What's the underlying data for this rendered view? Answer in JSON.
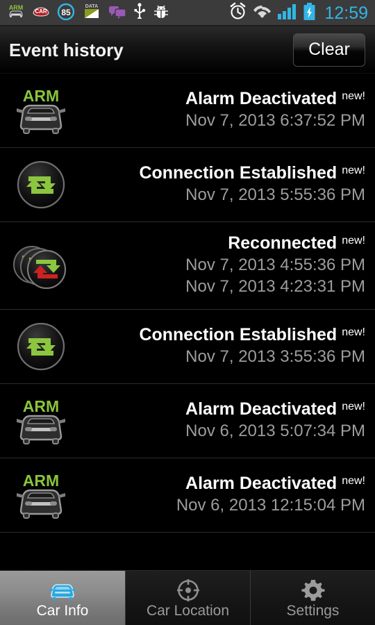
{
  "statusbar": {
    "left_icons": [
      {
        "name": "arm-car-notification-icon",
        "label": "ARM"
      },
      {
        "name": "car-alarm-app-icon",
        "label": "CAR"
      },
      {
        "name": "speed-85-icon",
        "label": "85"
      },
      {
        "name": "data-usage-icon",
        "label": "DATA"
      },
      {
        "name": "messages-icon",
        "label": ""
      },
      {
        "name": "usb-icon",
        "label": ""
      },
      {
        "name": "android-debug-icon",
        "label": ""
      }
    ],
    "right_icons": [
      {
        "name": "alarm-clock-icon"
      },
      {
        "name": "wifi-icon"
      },
      {
        "name": "cellular-signal-icon"
      },
      {
        "name": "battery-charging-icon"
      }
    ],
    "clock": "12:59",
    "accent_color": "#33b5e5"
  },
  "titlebar": {
    "title": "Event history",
    "clear_label": "Clear"
  },
  "events": [
    {
      "icon": "car-arm-icon",
      "icon_badge": "ARM",
      "title": "Alarm Deactivated",
      "badge": "new!",
      "times": [
        "Nov 7, 2013 6:37:52 PM"
      ]
    },
    {
      "icon": "connection-loop-icon",
      "icon_badge": "",
      "title": "Connection Established",
      "badge": "new!",
      "times": [
        "Nov 7, 2013 5:55:36 PM"
      ]
    },
    {
      "icon": "reconnected-stack-icon",
      "icon_badge": "",
      "title": "Reconnected",
      "badge": "new!",
      "times": [
        "Nov 7, 2013 4:55:36 PM",
        "Nov 7, 2013 4:23:31 PM"
      ]
    },
    {
      "icon": "connection-loop-icon",
      "icon_badge": "",
      "title": "Connection Established",
      "badge": "new!",
      "times": [
        "Nov 7, 2013 3:55:36 PM"
      ]
    },
    {
      "icon": "car-arm-icon",
      "icon_badge": "ARM",
      "title": "Alarm Deactivated",
      "badge": "new!",
      "times": [
        "Nov 6, 2013 5:07:34 PM"
      ]
    },
    {
      "icon": "car-arm-icon",
      "icon_badge": "ARM",
      "title": "Alarm Deactivated",
      "badge": "new!",
      "times": [
        "Nov 6, 2013 12:15:04 PM"
      ]
    }
  ],
  "tabs": [
    {
      "label": "Car Info",
      "icon": "car-front-icon",
      "active": true
    },
    {
      "label": "Car Location",
      "icon": "crosshair-target-icon",
      "active": false
    },
    {
      "label": "Settings",
      "icon": "gear-icon",
      "active": false
    }
  ],
  "colors": {
    "arm_green": "#8ac43c",
    "loop_green": "#8cc63f",
    "loop_red": "#cc2222",
    "active_tab_blue": "#33b5e5",
    "time_grey": "#9d9d9d"
  }
}
